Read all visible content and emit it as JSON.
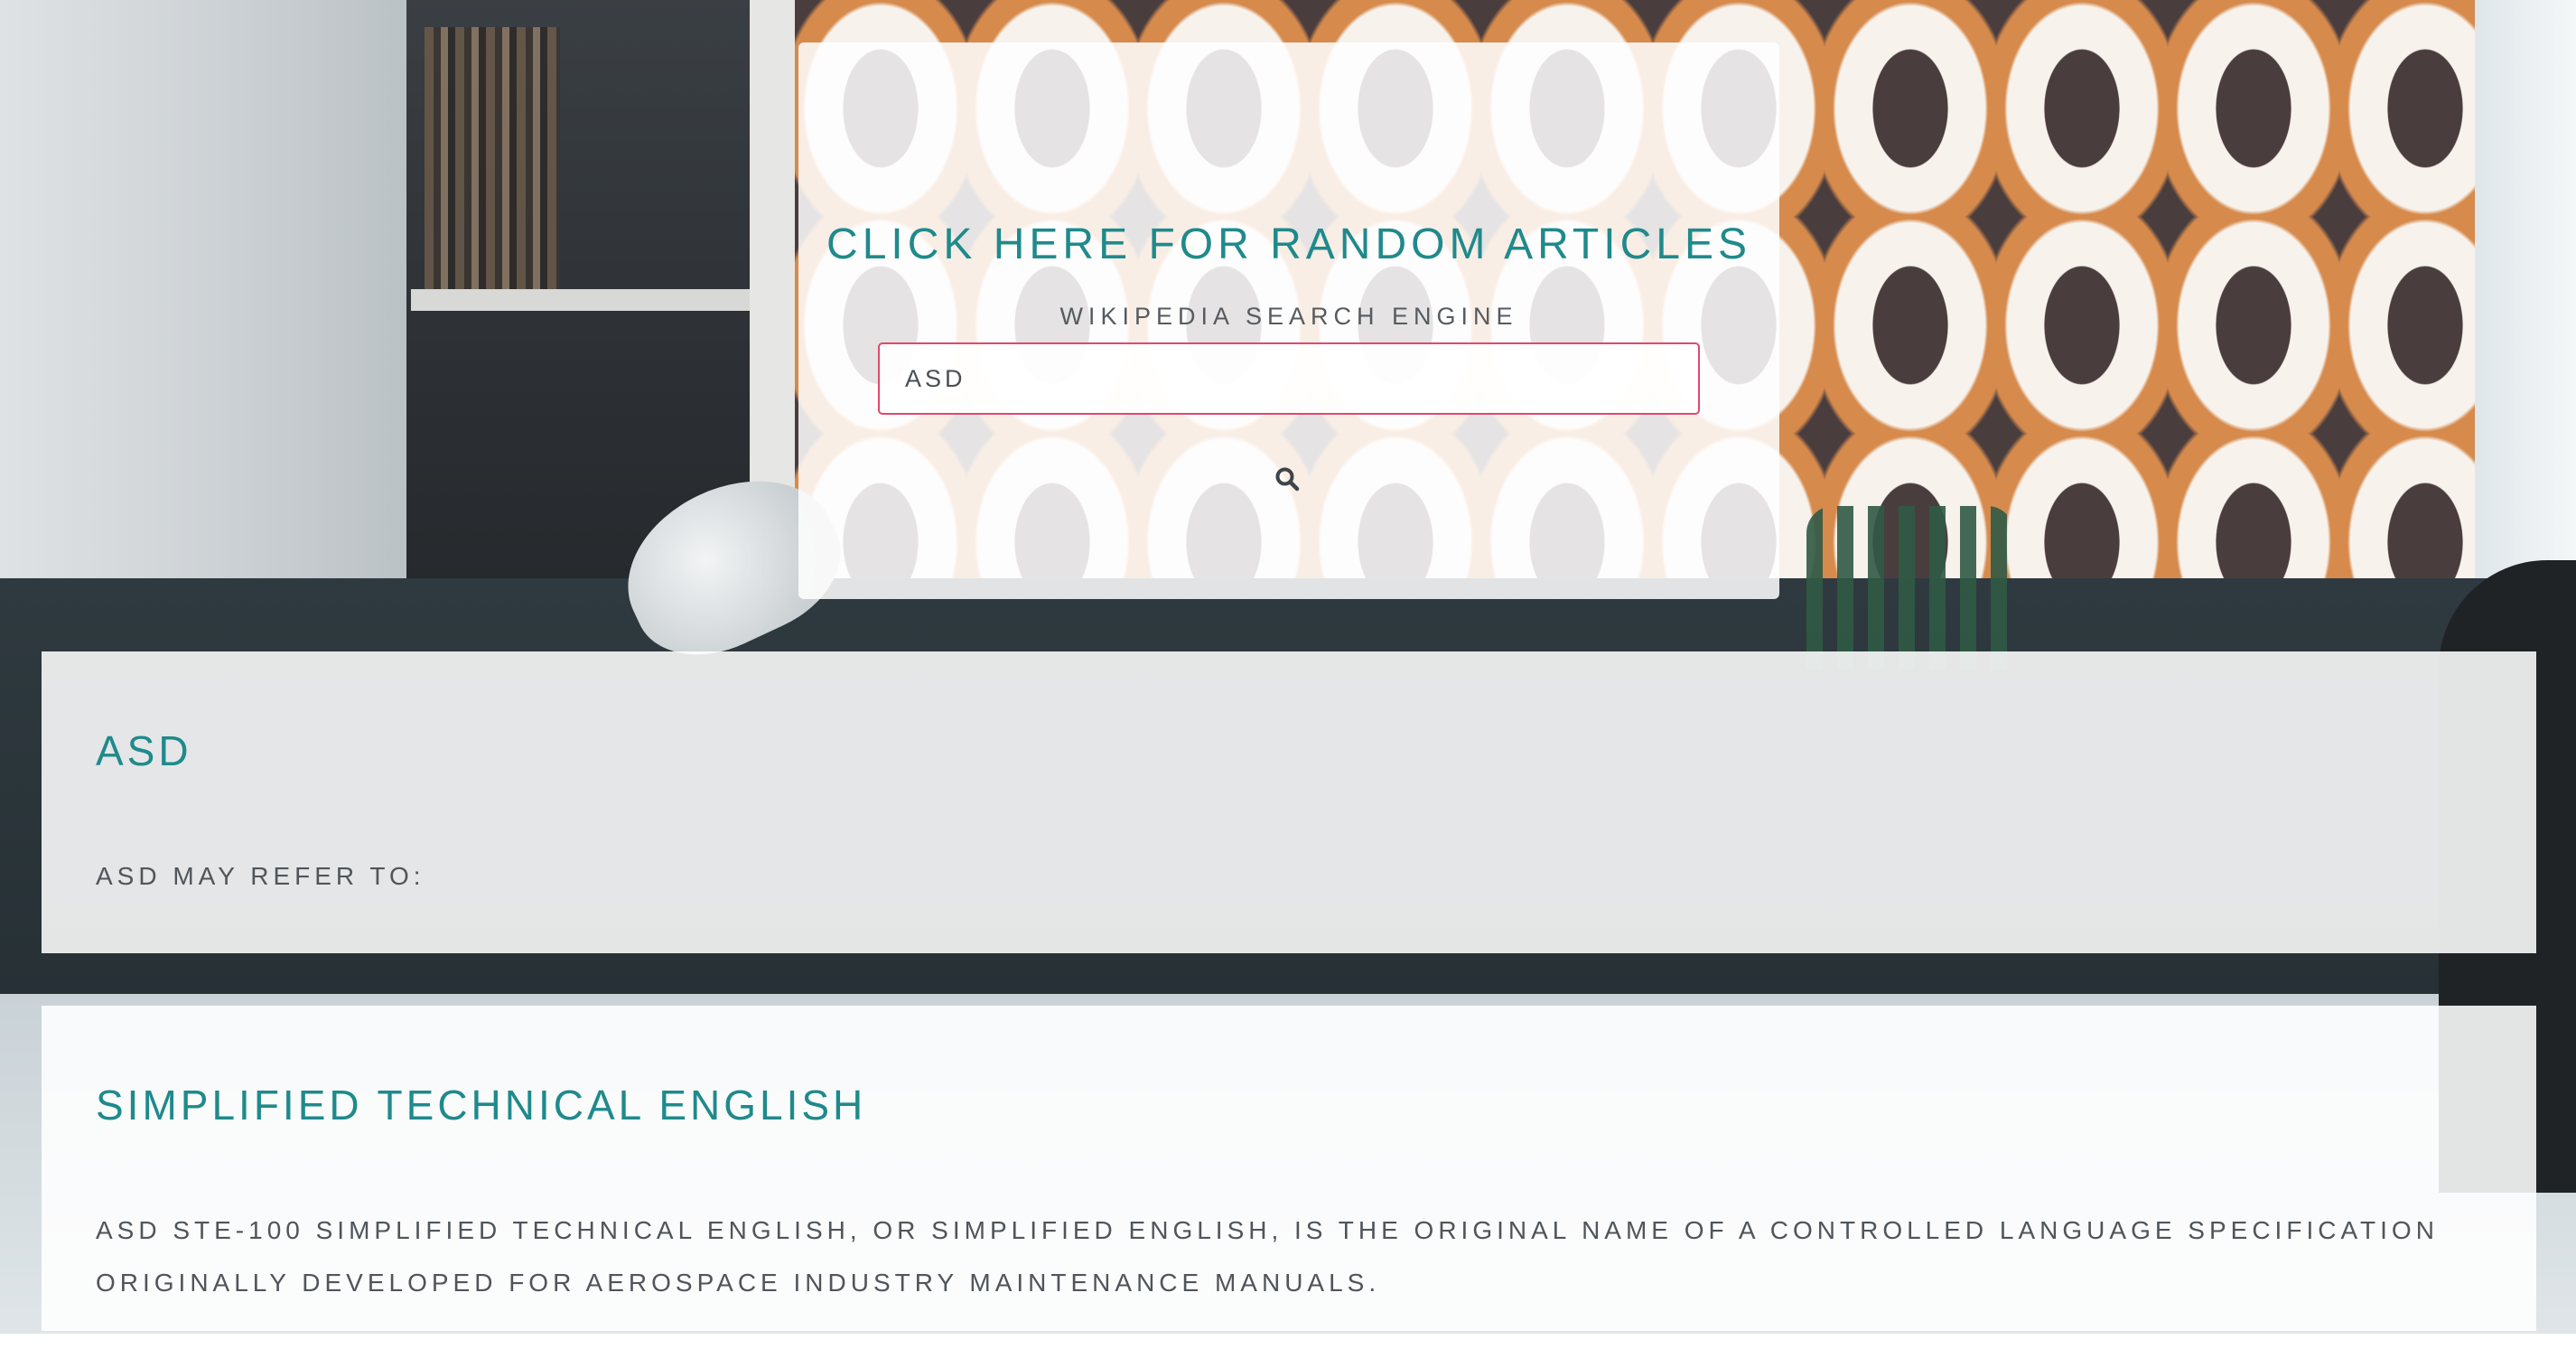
{
  "header": {
    "random_link_label": "CLICK HERE FOR RANDOM ARTICLES",
    "subtitle": "WIKIPEDIA SEARCH ENGINE"
  },
  "search": {
    "value": "ASD",
    "button_icon": "search-icon",
    "accent_color": "#e0486f"
  },
  "results": [
    {
      "title": "ASD",
      "snippet": "ASD MAY REFER TO:"
    },
    {
      "title": "SIMPLIFIED TECHNICAL ENGLISH",
      "snippet": "ASD STE-100 SIMPLIFIED TECHNICAL ENGLISH, OR SIMPLIFIED ENGLISH, IS THE ORIGINAL NAME OF A CONTROLLED LANGUAGE SPECIFICATION ORIGINALLY DEVELOPED FOR AEROSPACE INDUSTRY MAINTENANCE MANUALS."
    }
  ],
  "theme": {
    "title_color": "#1f8a8c",
    "text_color": "#4f555a"
  }
}
